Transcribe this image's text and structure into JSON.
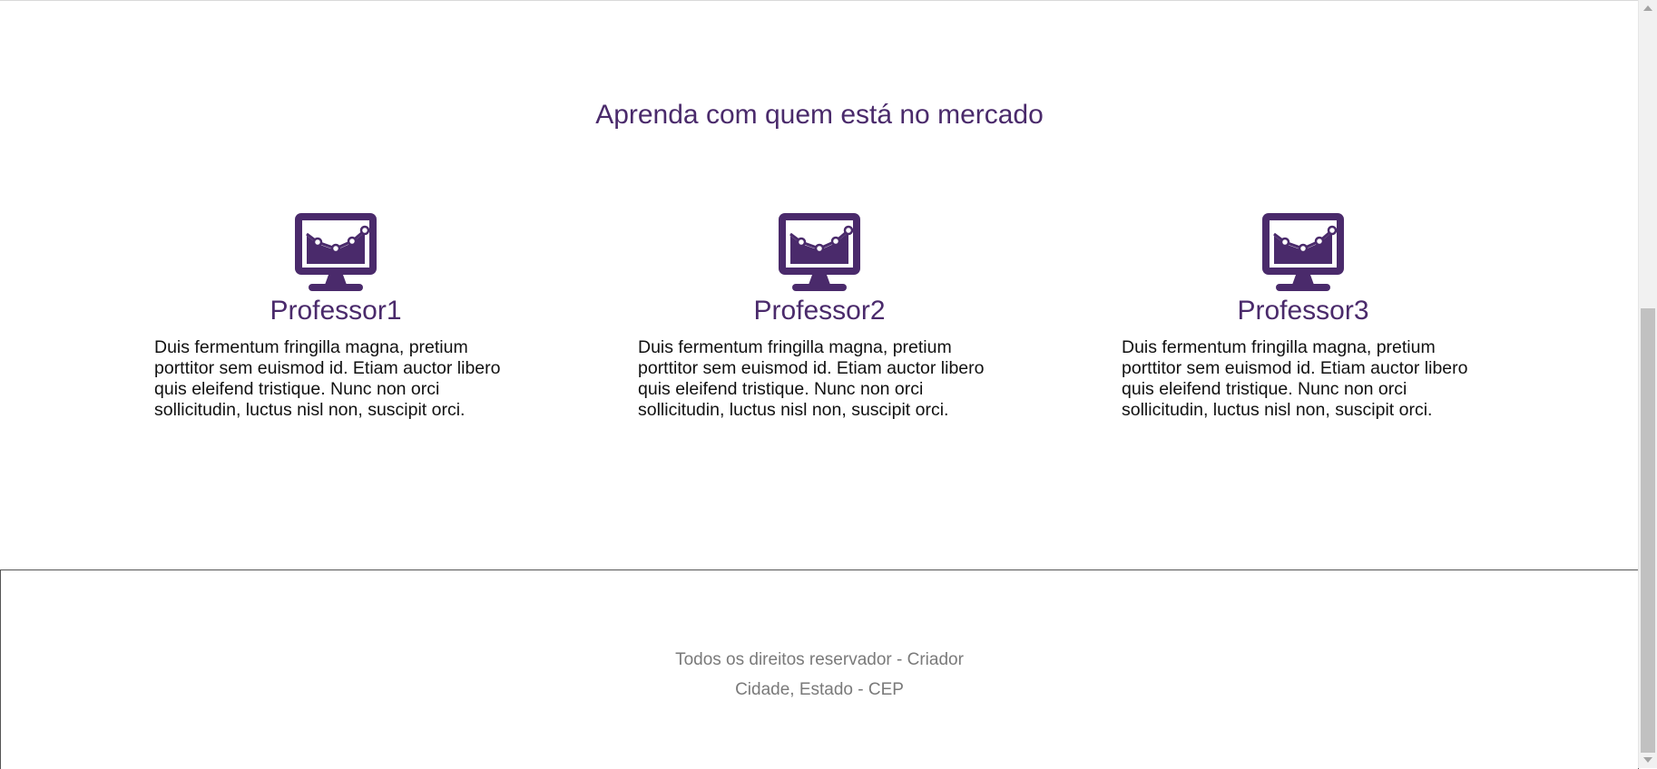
{
  "section": {
    "title": "Aprenda com quem está no mercado"
  },
  "professors": [
    {
      "name": "Professor1",
      "description": "Duis fermentum fringilla magna, pretium porttitor sem euismod id. Etiam auctor libero quis eleifend tristique. Nunc non orci sollicitudin, luctus nisl non, suscipit orci.",
      "icon": "monitor-chart-icon"
    },
    {
      "name": "Professor2",
      "description": "Duis fermentum fringilla magna, pretium porttitor sem euismod id. Etiam auctor libero quis eleifend tristique. Nunc non orci sollicitudin, luctus nisl non, suscipit orci.",
      "icon": "monitor-chart-icon"
    },
    {
      "name": "Professor3",
      "description": "Duis fermentum fringilla magna, pretium porttitor sem euismod id. Etiam auctor libero quis eleifend tristique. Nunc non orci sollicitudin, luctus nisl non, suscipit orci.",
      "icon": "monitor-chart-icon"
    }
  ],
  "footer": {
    "rights": "Todos os direitos reservador - Criador",
    "address": "Cidade, Estado - CEP"
  },
  "colors": {
    "accent": "#4a2a6b",
    "text": "#111111",
    "footer_text": "#7a7a7a"
  }
}
